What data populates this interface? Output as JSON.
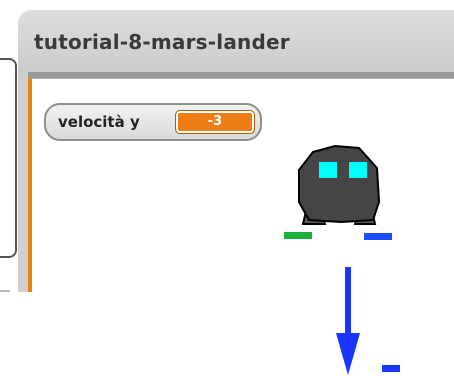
{
  "window": {
    "title": "tutorial-8-mars-lander"
  },
  "watcher": {
    "label": "velocità y",
    "value": "-3"
  },
  "sprites": {
    "lander": "lander-sprite",
    "arrow": "arrow-down-icon"
  },
  "colors": {
    "stage_border": "#e8820e",
    "watcher_value_bg": "#ee7d16",
    "lander_body": "#444444",
    "lander_windows": "#00ffff",
    "left_foot": "#19b23b",
    "right_foot": "#1a4dff",
    "arrow": "#1a35ff"
  }
}
